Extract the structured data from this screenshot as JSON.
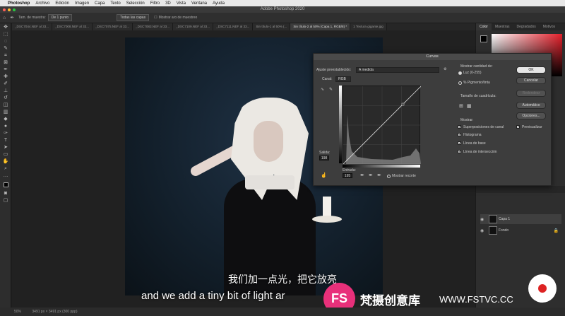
{
  "menubar": {
    "app": "Photoshop",
    "items": [
      "Archivo",
      "Edición",
      "Imagen",
      "Capa",
      "Texto",
      "Selección",
      "Filtro",
      "3D",
      "Vista",
      "Ventana",
      "Ayuda"
    ]
  },
  "window": {
    "title": "Adobe Photoshop 2020"
  },
  "options_bar": {
    "sample_size_label": "Tam. de muestra:",
    "sample_size_value": "De 1 punto",
    "sample_value": "Todas las capas",
    "extra": "Mostrar aro de muestreo"
  },
  "tabs": [
    "_DSC7044.NEF al 33...",
    "_DSC7008.NEF al 33...",
    "_DSC7075.NEF al 33...",
    "_DSC7083.NEF al 33...",
    "_DSC7109.NEF al 33...",
    "_DSC7111.NEF al 33...",
    "Sin título-1 al 50% (...",
    "Sin título-2 al 50% (Capa 1, RGB/8) *",
    "1 Textura gigante.jpg"
  ],
  "active_tab_index": 7,
  "panels": {
    "tabs": [
      "Color",
      "Muestras",
      "Degradados",
      "Motivos"
    ],
    "layers": [
      {
        "name": "Capa 1"
      },
      {
        "name": "Fondo"
      }
    ],
    "colors": {
      "foreground": "#000000",
      "background": "#ffffff"
    }
  },
  "curves": {
    "title": "Curvas",
    "preset_label": "Ajuste preestablecido:",
    "preset_value": "A medida",
    "channel_label": "Canal:",
    "channel_value": "RGB",
    "output_label": "Salida:",
    "output_value": "198",
    "input_label": "Entrada:",
    "input_value": "195",
    "show_clipping": "Mostrar recorte",
    "show_amount_label": "Mostrar cantidad de:",
    "light_option": "Luz (0-255)",
    "pigment_option": "% Pigmento/tinta",
    "grid_size_label": "Tamaño de cuadrícula:",
    "show_label": "Mostrar:",
    "checks": [
      "Superposiciones de canal",
      "Histograma",
      "Línea de base",
      "Línea de intersección"
    ],
    "buttons": {
      "ok": "OK",
      "cancel": "Cancelar",
      "smooth": "Redondear",
      "auto": "Automático",
      "options": "Opciones..."
    },
    "preview": "Previsualizar"
  },
  "subtitles": {
    "cn": "我们加一点光，把它放亮",
    "en": "and we add a tiny bit of light ar"
  },
  "watermark": {
    "logo": "FS",
    "cn": "梵摄创意库",
    "url": "WWW.FSTVC.CC"
  },
  "status": {
    "zoom": "50%",
    "doc": "3491 px × 3491 px (300 ppp)"
  }
}
